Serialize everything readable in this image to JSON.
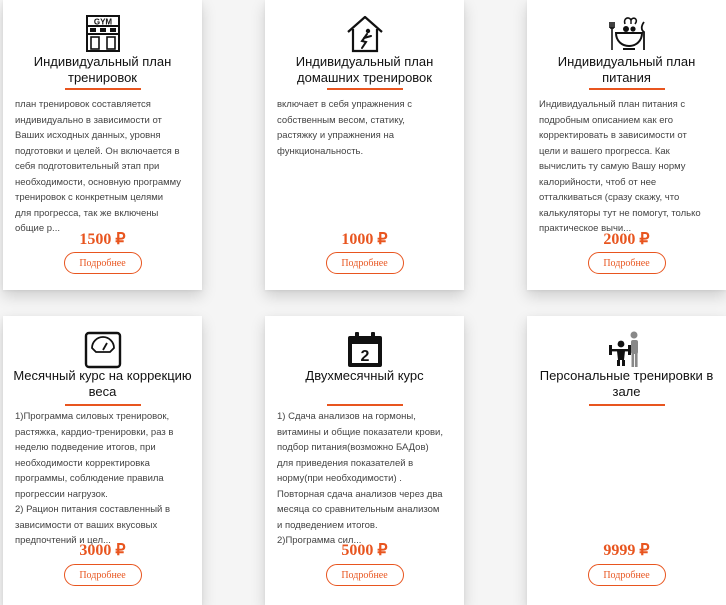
{
  "cards": [
    {
      "icon": "gym-icon",
      "title": "Индивидуальный план\nтренировок",
      "description": "план тренировок составляется\nиндивидуально в зависимости от\nВаших исходных данных, уровня\nподготовки и целей. Он включается в\nсебя подготовительный этап при\nнеобходимости, основную программу\nтренировок с конкретным целями\nдля прогресса, так же включены\nобщие р...",
      "price": "1500 ₽",
      "button": "Подробнее"
    },
    {
      "icon": "home-workout-icon",
      "title": "Индивидуальный план\nдомашних тренировок",
      "description": "включает в себя упражнения с\nсобственным весом, статику,\nрастяжку и упражнения на\nфункциональность.",
      "price": "1000 ₽",
      "button": "Подробнее"
    },
    {
      "icon": "nutrition-bowl-icon",
      "title": "Индивидуальный план\nпитания",
      "description": "Индивидуальный план питания с\nподробным описанием как его\nкорректировать в зависимости от\nцели и вашего прогресса. Как\nвычислить ту самую Вашу норму\nкалорийности, чтоб от нее\nотталкиваться (сразу скажу, что\nкалькуляторы тут не помогут, только\nпрактическое вычи...",
      "price": "2000 ₽",
      "button": "Подробнее"
    },
    {
      "icon": "scale-icon",
      "title": "Месячный курс на коррекцию\nвеса",
      "description": "1)Программа силовых тренировок,\nрастяжка, кардио-тренировки, раз в\nнеделю подведение итогов, при\nнеобходимости корректировка\nпрограммы, соблюдение правила\nпрогрессии нагрузок.\n2) Рацион питания составленный в\nзависимости от ваших вкусовых\nпредпочтений и цел...",
      "price": "3000 ₽",
      "button": "Подробнее"
    },
    {
      "icon": "calendar-2-icon",
      "title": "Двухмесячный курс",
      "description": "1) Сдача анализов на гормоны,\nвитамины и общие показатели крови,\nподбор питания(возможно БАДов)\nдля приведения показателей в\nнорму(при необходимости) .\nПовторная сдача анализов через два\nмесяца со сравнительным анализом\nи подведением итогов.\n2)Программа сил...",
      "price": "5000 ₽",
      "button": "Подробнее"
    },
    {
      "icon": "personal-trainer-icon",
      "title": "Персональные тренировки в\nзале",
      "description": "",
      "price": "9999 ₽",
      "button": "Подробнее"
    }
  ],
  "colors": {
    "accent": "#e8551f",
    "text": "#444444",
    "title": "#111111",
    "icon_accent": "#888888"
  }
}
